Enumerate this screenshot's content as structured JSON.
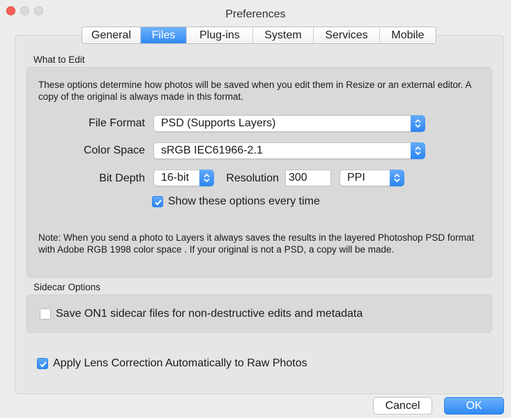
{
  "window": {
    "title": "Preferences"
  },
  "tabs": [
    {
      "label": "General"
    },
    {
      "label": "Files",
      "active": true
    },
    {
      "label": "Plug-ins"
    },
    {
      "label": "System"
    },
    {
      "label": "Services"
    },
    {
      "label": "Mobile"
    }
  ],
  "what_to_edit": {
    "section_label": "What to Edit",
    "description": "These options determine how photos will be saved when you edit them in Resize or an external editor.  A copy of the original is always made in this format.",
    "file_format": {
      "label": "File Format",
      "value": "PSD (Supports Layers)"
    },
    "color_space": {
      "label": "Color Space",
      "value": "sRGB IEC61966-2.1"
    },
    "bit_depth": {
      "label": "Bit Depth",
      "value": "16-bit"
    },
    "resolution": {
      "label": "Resolution",
      "value": "300",
      "unit": "PPI"
    },
    "show_options": {
      "label": "Show these options every time",
      "checked": true
    },
    "note": "Note: When you send a photo to Layers it always saves the results in the layered Photoshop PSD format with Adobe RGB 1998 color space .  If your original is not a PSD, a copy will be made."
  },
  "sidecar": {
    "section_label": "Sidecar Options",
    "save_sidecar": {
      "label": "Save ON1 sidecar files for non-destructive edits and metadata",
      "checked": false
    }
  },
  "lens_correction": {
    "label": "Apply Lens Correction Automatically to Raw Photos",
    "checked": true
  },
  "buttons": {
    "cancel": "Cancel",
    "ok": "OK"
  },
  "colors": {
    "accent": "#2f89f5",
    "close": "#fc5f57"
  }
}
